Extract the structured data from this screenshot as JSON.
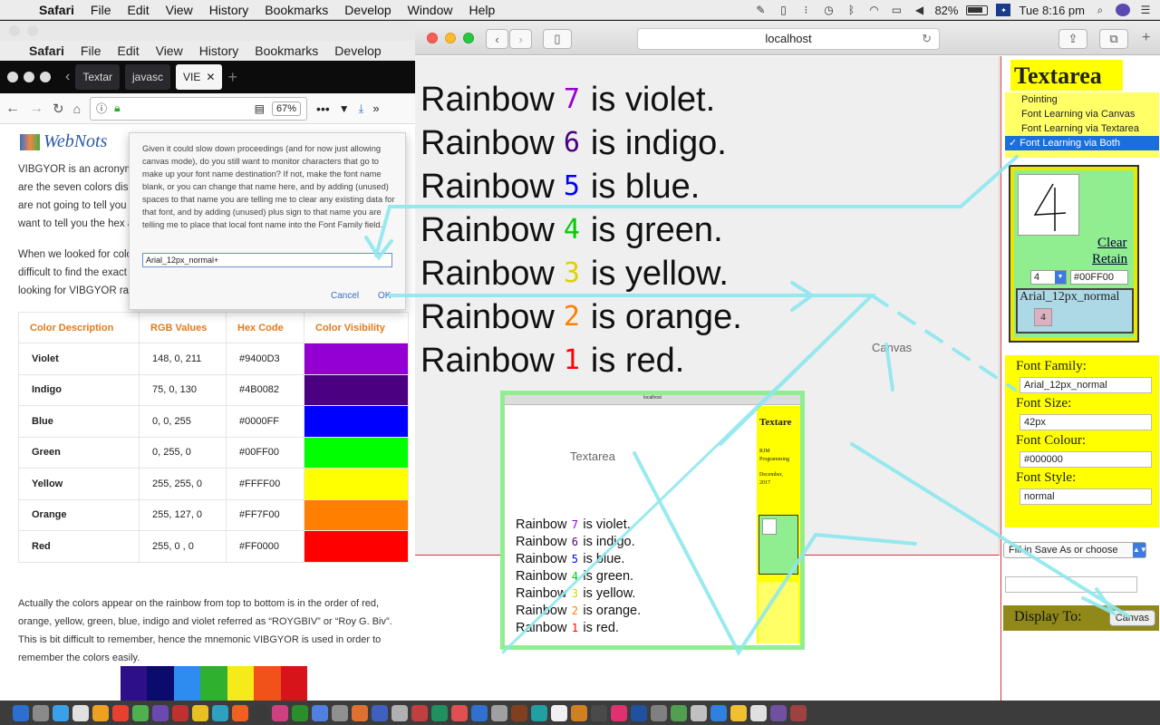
{
  "menubar": {
    "app": "Safari",
    "items": [
      "File",
      "Edit",
      "View",
      "History",
      "Bookmarks",
      "Develop",
      "Window",
      "Help"
    ],
    "battery": "82%",
    "time": "Tue 8:16 pm"
  },
  "left_window": {
    "menu": {
      "app": "Safari",
      "items": [
        "File",
        "Edit",
        "View",
        "History",
        "Bookmarks",
        "Develop"
      ]
    },
    "tabs": [
      "Textar",
      "javasc",
      "VIE"
    ],
    "zoom": "67%",
    "logo": "WebNots",
    "para1_lines": [
      "VIBGYOR is an acronym f",
      "are the seven colors disp",
      "are not going to tell you",
      "want to tell you the hex a"
    ],
    "para2_lines": [
      "When we looked for colo",
      "difficult to find the exact",
      "looking for VIBGYOR rain"
    ],
    "table": {
      "headers": [
        "Color Description",
        "RGB Values",
        "Hex Code",
        "Color Visibility"
      ],
      "rows": [
        {
          "name": "Violet",
          "rgb": "148, 0, 211",
          "hex": "#9400D3",
          "swatch": "#9400D3"
        },
        {
          "name": "Indigo",
          "rgb": "75, 0, 130",
          "hex": "#4B0082",
          "swatch": "#4B0082"
        },
        {
          "name": "Blue",
          "rgb": "0, 0, 255",
          "hex": "#0000FF",
          "swatch": "#0000FF"
        },
        {
          "name": "Green",
          "rgb": "0, 255, 0",
          "hex": "#00FF00",
          "swatch": "#00FF00"
        },
        {
          "name": "Yellow",
          "rgb": "255, 255, 0",
          "hex": "#FFFF00",
          "swatch": "#FFFF00"
        },
        {
          "name": "Orange",
          "rgb": "255, 127, 0",
          "hex": "#FF7F00",
          "swatch": "#FF7F00"
        },
        {
          "name": "Red",
          "rgb": "255, 0 , 0",
          "hex": "#FF0000",
          "swatch": "#FF0000"
        }
      ]
    },
    "para3": "Actually the colors appear on the rainbow from top to bottom is in the order of red, orange, yellow, green, blue, indigo and violet referred as “ROYGBIV” or “Roy G. Biv”. This is bit difficult to remember, hence the mnemonic VIBGYOR is used in order to remember the colors easily.",
    "stripe_colors": [
      "#2e0f8a",
      "#0b0b6e",
      "#2e8cf0",
      "#2fb02f",
      "#f5ea1a",
      "#f0521a",
      "#d6141a"
    ]
  },
  "dialog": {
    "message": "Given it could slow down proceedings (and for now just allowing canvas mode), do you still want to monitor characters that go to make up your font name destination? If not, make the font name blank, or you can change that name here, and by adding (unused) spaces to that name you are telling me to clear any existing data for that font, and by adding (unused) plus sign to that name you are telling me to place that local font name into the Font Family field.",
    "input_value": "Arial_12px_normal+",
    "cancel": "Cancel",
    "ok": "OK"
  },
  "safari": {
    "url": "localhost",
    "rainbow_lines": [
      {
        "prefix": "Rainbow",
        "glyph": "7",
        "suffix": "is violet.",
        "color": "#9400D3"
      },
      {
        "prefix": "Rainbow",
        "glyph": "6",
        "suffix": "is indigo.",
        "color": "#4B0082"
      },
      {
        "prefix": "Rainbow",
        "glyph": "5",
        "suffix": "is blue.",
        "color": "#0000FF"
      },
      {
        "prefix": "Rainbow",
        "glyph": "4",
        "suffix": "is green.",
        "color": "#00CC00"
      },
      {
        "prefix": "Rainbow",
        "glyph": "3",
        "suffix": "is yellow.",
        "color": "#E0D000"
      },
      {
        "prefix": "Rainbow",
        "glyph": "2",
        "suffix": "is orange.",
        "color": "#FF7F00"
      },
      {
        "prefix": "Rainbow",
        "glyph": "1",
        "suffix": "is red.",
        "color": "#FF0000"
      }
    ],
    "canvas_label": "Canvas",
    "nested": {
      "url": "localhost",
      "label": "Textarea",
      "lines": [
        "is violet.",
        "is indigo.",
        "is blue.",
        "is green.",
        "is yellow.",
        "is orange.",
        "is red."
      ],
      "word": "Rainbow",
      "sidebar_title": "Textare",
      "sidebar_text": [
        "RJM",
        "Programming",
        "December,",
        "2017"
      ]
    }
  },
  "sidebar": {
    "title": "Textarea",
    "modes": [
      "Pointing",
      "Font Learning via Canvas",
      "Font Learning via Textarea",
      "Font Learning via Both"
    ],
    "selected_mode_index": 3,
    "check": "✓",
    "clear": "Clear",
    "retain": "Retain",
    "glyph_select": "4",
    "color_value": "#00FF00",
    "font_name": "Arial_12px_normal",
    "font_char": "4",
    "font_family_label": "Font Family:",
    "font_family_value": "Arial_12px_normal",
    "font_size_label": "Font Size:",
    "font_size_value": "42px",
    "font_colour_label": "Font Colour:",
    "font_colour_value": "#000000",
    "font_style_label": "Font Style:",
    "font_style_value": "normal",
    "saveas_placeholder": "Fill in Save As or choose",
    "display_to_label": "Display To:",
    "display_to_button": "Canvas"
  },
  "colors": {
    "annotation": "#8ee8ee",
    "selection": "#1a6fdb",
    "panel_yellow": "#ffff00",
    "panel_green": "#90ee90"
  }
}
